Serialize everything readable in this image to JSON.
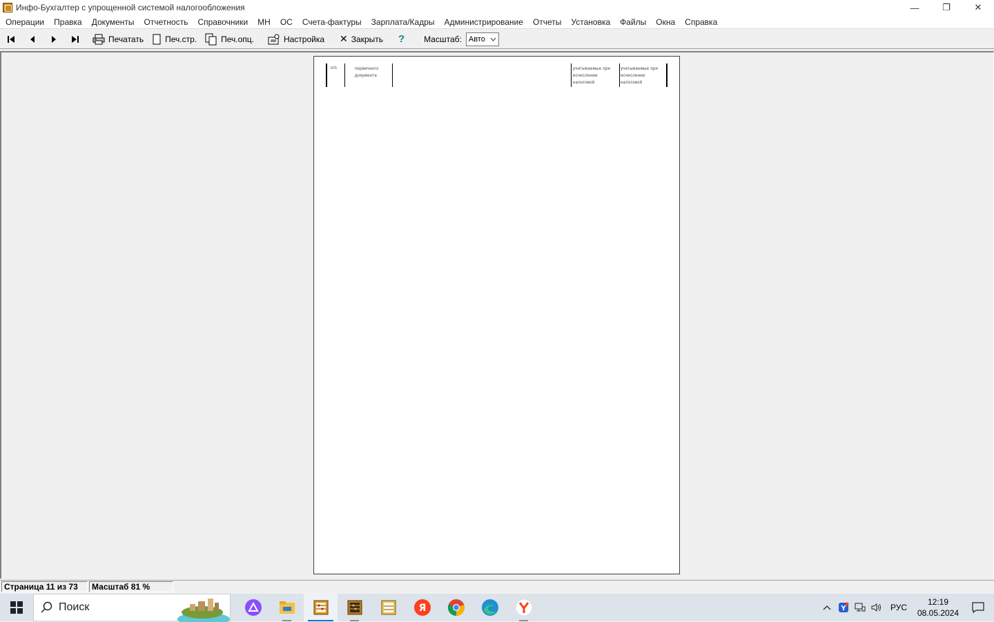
{
  "window": {
    "title": "Инфо-Бухгалтер с упрощенной системой налогообложения",
    "minimize": "—",
    "restore": "❐",
    "close": "✕"
  },
  "menu": [
    "Операции",
    "Правка",
    "Документы",
    "Отчетность",
    "Справочники",
    "МН",
    "ОС",
    "Счета-фактуры",
    "Зарплата/Кадры",
    "Администрирование",
    "Отчеты",
    "Установка",
    "Файлы",
    "Окна",
    "Справка"
  ],
  "toolbar": {
    "print": "Печатать",
    "print_page": "Печ.стр.",
    "print_options": "Печ.опц.",
    "settings": "Настройка",
    "close": "Закрыть",
    "help": "?",
    "scale_label": "Масштаб:",
    "scale_value": "Авто"
  },
  "preview_page": {
    "col_number": "п/п",
    "col_doc_1": "первичного",
    "col_doc_2": "документа",
    "col_a_1": "учитываемые    при",
    "col_a_2": "исчислении",
    "col_a_3": "налоговой",
    "col_b_1": "учитываемые    при",
    "col_b_2": "исчислении",
    "col_b_3": "налоговой"
  },
  "status": {
    "page": "Страница 11 из 73",
    "scale": "Масштаб 81 %"
  },
  "taskbar": {
    "search_placeholder": "Поиск",
    "language": "РУС",
    "time": "12:19",
    "date": "08.05.2024"
  },
  "colors": {
    "taskbar_accent": "#0078d4",
    "yandex_red": "#fc3f1d",
    "alice_purple": "#8a4dff"
  }
}
